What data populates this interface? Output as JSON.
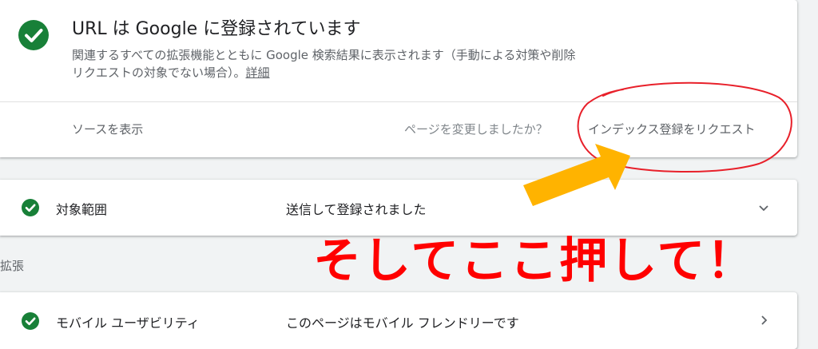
{
  "status_card": {
    "title": "URL は Google に登録されています",
    "description": "関連するすべての拡張機能とともに Google 検索結果に表示されます（手動による対策や削除リクエストの対象でない場合）。",
    "details_link": "詳細",
    "view_source": "ソースを表示",
    "changed_question": "ページを変更しましたか？",
    "request_indexing": "インデックス登録をリクエスト"
  },
  "coverage": {
    "label": "対象範囲",
    "value": "送信して登録されました"
  },
  "section_label": "拡張",
  "mobile_usability": {
    "label": "モバイル ユーザビリティ",
    "value": "このページはモバイル フレンドリーです"
  },
  "annotation": {
    "text": "そしてここ押して！"
  },
  "colors": {
    "success_green": "#188038",
    "annotation_red": "#ff0000",
    "arrow_orange": "#ffb300"
  },
  "icons": {
    "status": "check-circle-icon",
    "coverage": "check-circle-icon",
    "coverage_expand": "chevron-down-icon",
    "mobile": "check-circle-icon",
    "mobile_open": "chevron-right-icon"
  }
}
